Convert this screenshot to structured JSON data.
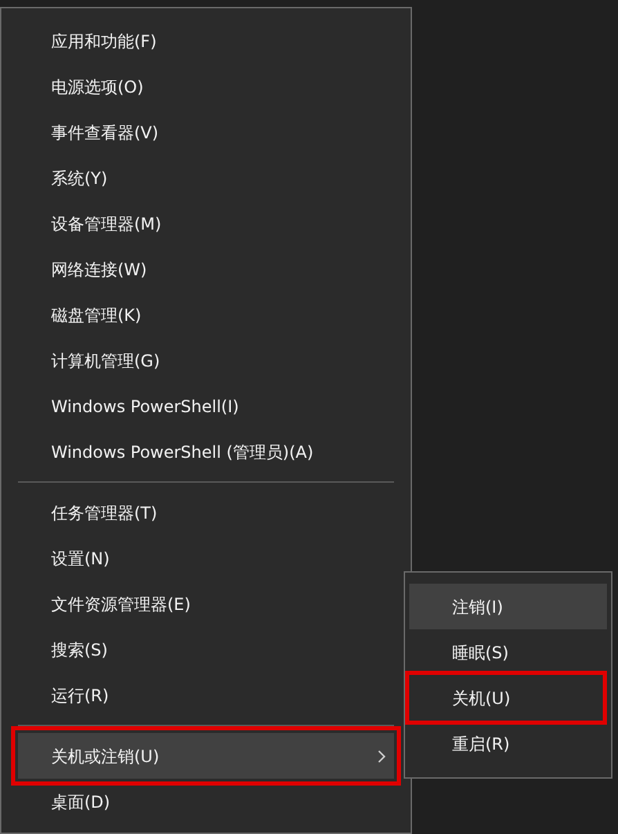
{
  "menu": {
    "groups": [
      {
        "items": [
          {
            "label": "应用和功能(F)",
            "kind": "item",
            "selected": false,
            "annotated": false
          },
          {
            "label": "电源选项(O)",
            "kind": "item",
            "selected": false,
            "annotated": false
          },
          {
            "label": "事件查看器(V)",
            "kind": "item",
            "selected": false,
            "annotated": false
          },
          {
            "label": "系统(Y)",
            "kind": "item",
            "selected": false,
            "annotated": false
          },
          {
            "label": "设备管理器(M)",
            "kind": "item",
            "selected": false,
            "annotated": false
          },
          {
            "label": "网络连接(W)",
            "kind": "item",
            "selected": false,
            "annotated": false
          },
          {
            "label": "磁盘管理(K)",
            "kind": "item",
            "selected": false,
            "annotated": false
          },
          {
            "label": "计算机管理(G)",
            "kind": "item",
            "selected": false,
            "annotated": false
          },
          {
            "label": "Windows PowerShell(I)",
            "kind": "item",
            "selected": false,
            "annotated": false
          },
          {
            "label": "Windows PowerShell (管理员)(A)",
            "kind": "item",
            "selected": false,
            "annotated": false
          }
        ]
      },
      {
        "items": [
          {
            "label": "任务管理器(T)",
            "kind": "item",
            "selected": false,
            "annotated": false
          },
          {
            "label": "设置(N)",
            "kind": "item",
            "selected": false,
            "annotated": false
          },
          {
            "label": "文件资源管理器(E)",
            "kind": "item",
            "selected": false,
            "annotated": false
          },
          {
            "label": "搜索(S)",
            "kind": "item",
            "selected": false,
            "annotated": false
          },
          {
            "label": "运行(R)",
            "kind": "item",
            "selected": false,
            "annotated": false
          }
        ]
      },
      {
        "items": [
          {
            "label": "关机或注销(U)",
            "kind": "submenu",
            "selected": true,
            "annotated": true
          },
          {
            "label": "桌面(D)",
            "kind": "item",
            "selected": false,
            "annotated": false
          }
        ]
      }
    ]
  },
  "submenu": {
    "items": [
      {
        "label": "注销(I)",
        "selected": true,
        "annotated": false
      },
      {
        "label": "睡眠(S)",
        "selected": false,
        "annotated": false
      },
      {
        "label": "关机(U)",
        "selected": false,
        "annotated": true
      },
      {
        "label": "重启(R)",
        "selected": false,
        "annotated": false
      }
    ]
  }
}
